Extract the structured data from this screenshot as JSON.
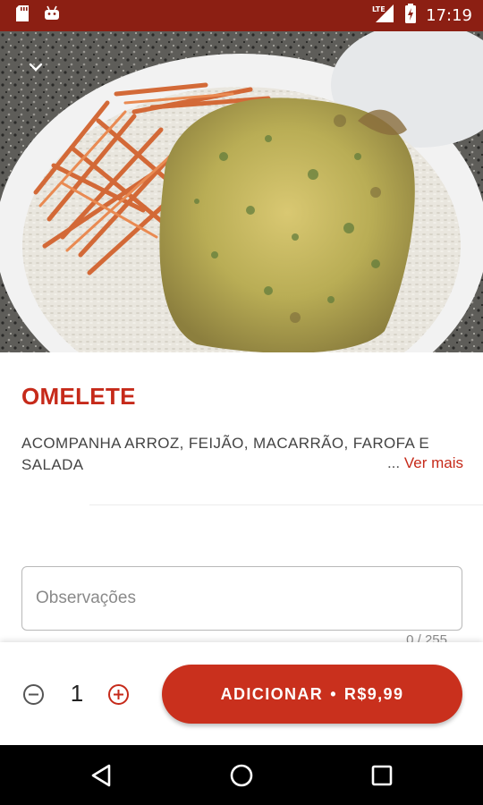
{
  "status_bar": {
    "time": "17:19",
    "network": "LTE",
    "icons": [
      "sd-card-icon",
      "android-icon",
      "lte-signal-icon",
      "battery-charging-icon"
    ]
  },
  "hero": {
    "image_alt": "omelete-photo",
    "collapse_icon": "chevron-down-icon"
  },
  "product": {
    "title": "OMELETE",
    "description": "ACOMPANHA ARROZ, FEIJÃO, MACARRÃO, FAROFA E SALADA",
    "ellipsis": "... ",
    "see_more": "Ver mais"
  },
  "notes": {
    "placeholder": "Observações",
    "value": "",
    "counter": "0 / 255"
  },
  "order": {
    "quantity": "1",
    "add_label": "ADICIONAR",
    "separator": "•",
    "price": "R$9,99"
  },
  "colors": {
    "status_bar": "#8c1f13",
    "accent": "#c62a1a",
    "button": "#c9301d"
  }
}
